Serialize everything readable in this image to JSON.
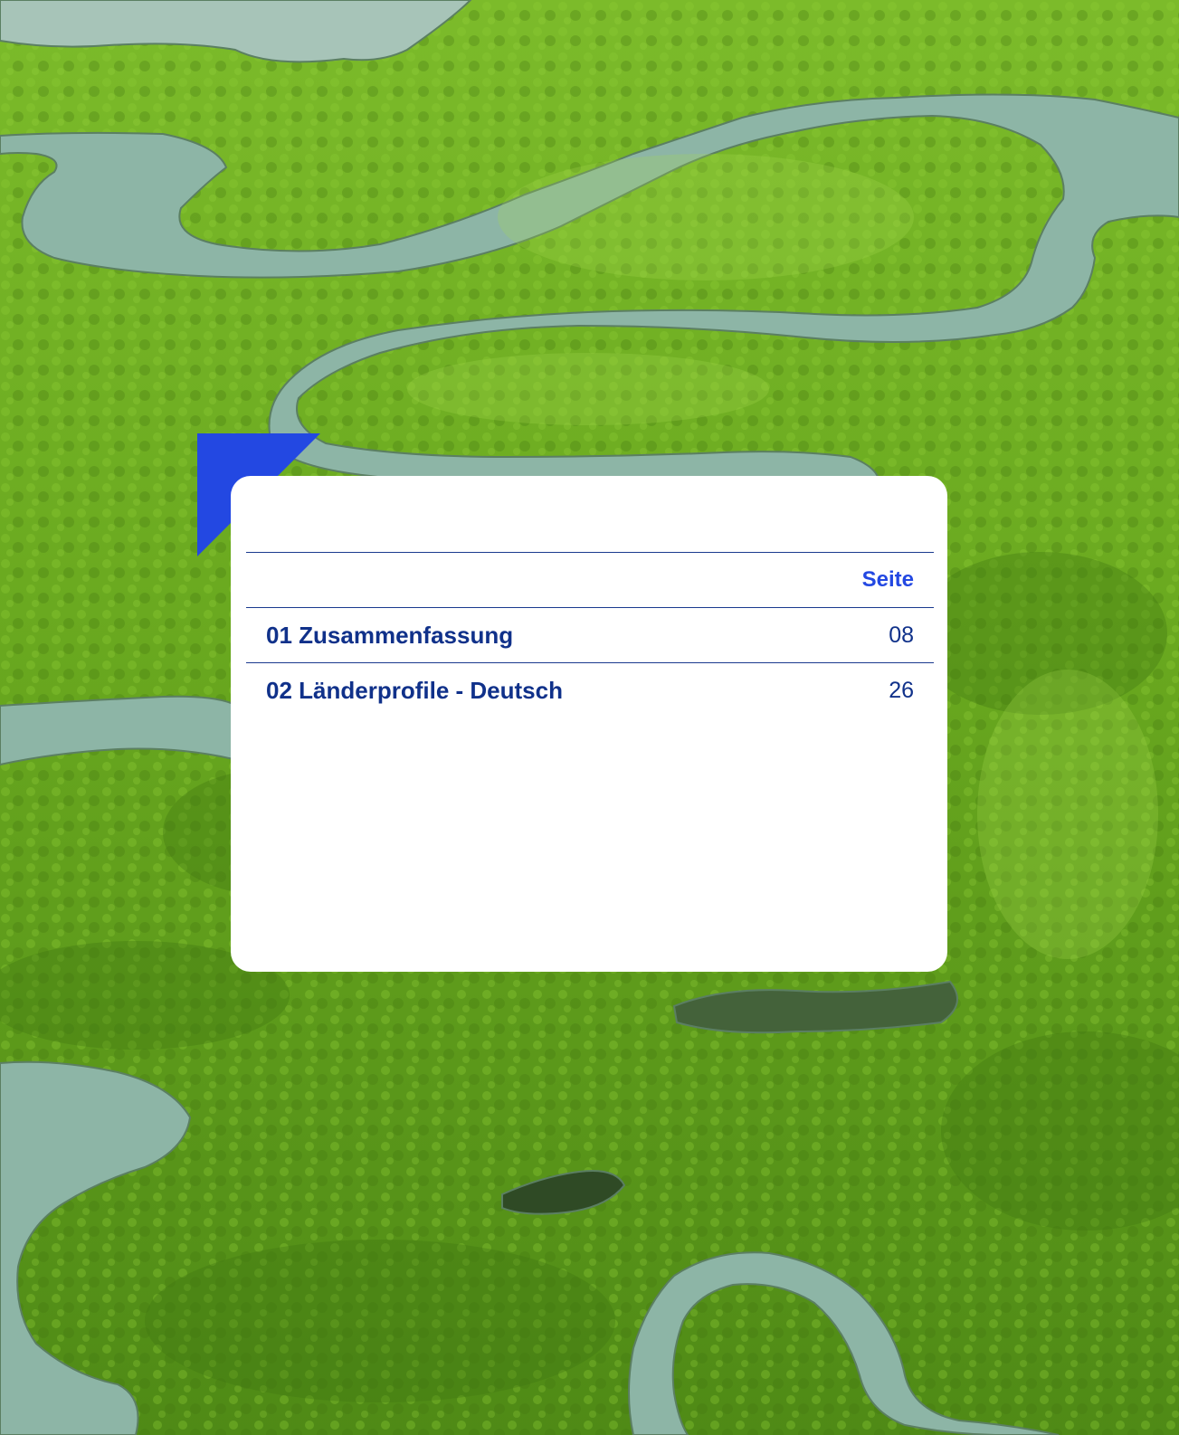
{
  "toc": {
    "header": {
      "page_label": "Seite"
    },
    "entries": [
      {
        "title": "01 Zusammenfassung",
        "page": "08"
      },
      {
        "title": "02 Länderprofile - Deutsch",
        "page": "26"
      }
    ]
  },
  "colors": {
    "accent": "#2348e2",
    "text": "#10318a",
    "card": "#ffffff",
    "forest": "#5d9a1e",
    "water": "#8fb3a5"
  },
  "icons": {
    "corner": "blue-triangle-accent"
  }
}
